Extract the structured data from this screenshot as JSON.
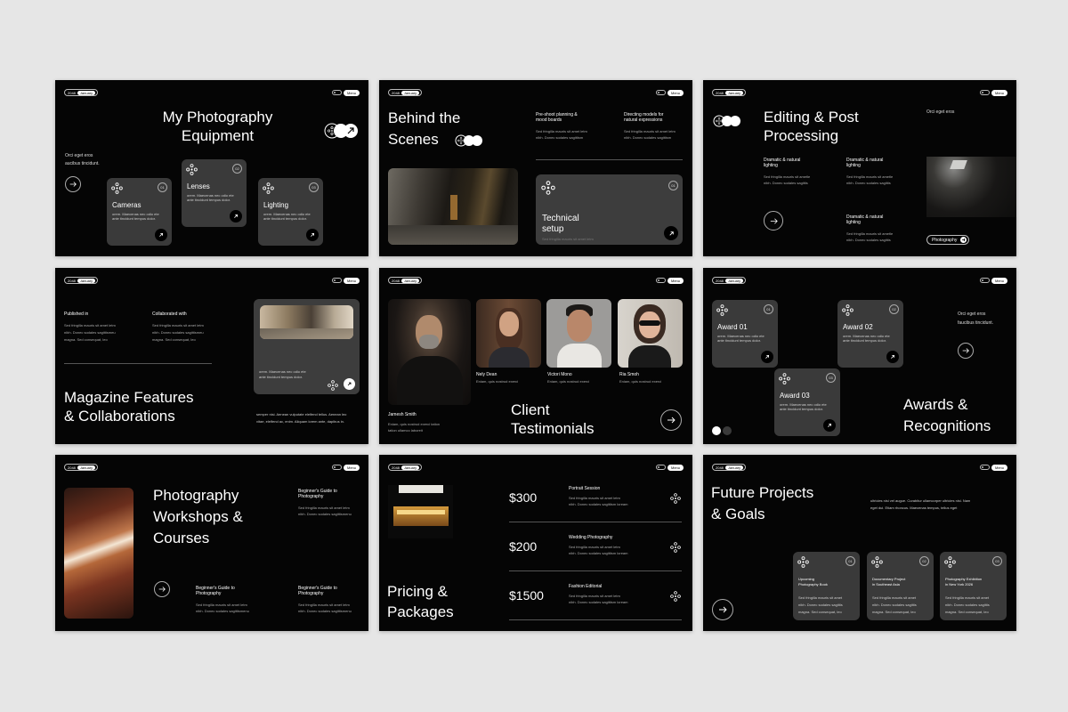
{
  "common": {
    "year": "2048",
    "month": "January",
    "menu": "Menu"
  },
  "s1": {
    "title": "My Photography Equipment",
    "intro1": "Orci eget eros",
    "intro2": "aucibus tincidunt.",
    "cards": [
      {
        "num": "01",
        "title": "Cameras",
        "desc1": "orem. Maecenas nec odio ete",
        "desc2": "ante tincidunt tempus dolor."
      },
      {
        "num": "02",
        "title": "Lenses",
        "desc1": "orem. Maecenas nec odio ete",
        "desc2": "ante tincidunt tempus dolor."
      },
      {
        "num": "03",
        "title": "Lighting",
        "desc1": "orem. Maecenas nec odio ete",
        "desc2": "ante tincidunt tempus dolor."
      }
    ]
  },
  "s2": {
    "title1": "Behind the",
    "title2": "Scenes",
    "col1h1": "Pre-shoot planning &",
    "col1h2": "mood boards",
    "col2h1": "Directing models for",
    "col2h2": "natural expressions",
    "body1": "Sed fringilla mauris sit amet letm",
    "body2": "nibh. Donec sodales sagittism",
    "card_num": "01",
    "card_t1": "Technical",
    "card_t2": "setup",
    "card_desc": "Sed fringilla mauris sit amet letm"
  },
  "s3": {
    "title1": "Editing & Post",
    "title2": "Processing",
    "aside": "Orci eget eros",
    "h1a": "Dramatic & natural",
    "h1b": "lighting",
    "body1": "Sed fringilla mauris sit ametle",
    "body2": "nibh. Donec sodales sagittis",
    "tag": "Photography"
  },
  "s4": {
    "label1": "Published in",
    "label2": "Collaborated with",
    "body1": "Sed fringilla mauris sit amet letm",
    "body2": "nibh. Donec sodales sagittismeu",
    "body3": "magna. Sed consequat, leo",
    "title1": "Magazine Features",
    "title2": "& Collaborations",
    "card1": "orem. Maecenas nec odio ete",
    "card2": "ante tincidunt tempus dolor.",
    "foot1": "semper nisi. Aenean vulputate eleifend tellus. Aenean leo",
    "foot2": "vitae, eleifend ac, enim. Aliquam lorem ante, dapibus in."
  },
  "s5": {
    "people": [
      {
        "name": "Jamesh Smith",
        "d1": "Eniam, quis nostrud exerci tation",
        "d2": "tation ullamco laboreit"
      },
      {
        "name": "Nely Dean",
        "d1": "Eniam, quis nostrud exerci",
        "d2": ""
      },
      {
        "name": "Victori Mono",
        "d1": "Eniam, quis nostrud exerci",
        "d2": ""
      },
      {
        "name": "Ria Smoh",
        "d1": "Eniam, quis nostrud exerci",
        "d2": ""
      }
    ],
    "title1": "Client",
    "title2": "Testimonials"
  },
  "s6": {
    "cards": [
      {
        "num": "01",
        "title": "Award 01"
      },
      {
        "num": "02",
        "title": "Award 02"
      },
      {
        "num": "03",
        "title": "Award 03"
      }
    ],
    "desc1": "orem. Maecenas nec odio ete",
    "desc2": "ante tincidunt tempus dolor.",
    "aside1": "Orci eget eros",
    "aside2": "faucibus tincidunt.",
    "title1": "Awards &",
    "title2": "Recognitions"
  },
  "s7": {
    "title1": "Photography",
    "title2": "Workshops &",
    "title3": "Courses",
    "guide1": "Beginner's Guide to",
    "guide2": "Photography",
    "body1": "Sed fringilla mauris sit amet letm",
    "body2": "nibh. Donec sodales sagittismenu"
  },
  "s8": {
    "prices": [
      {
        "price": "$300",
        "label": "Portrait Session"
      },
      {
        "price": "$200",
        "label": "Wedding Photography"
      },
      {
        "price": "$1500",
        "label": "Fashion Editorial"
      }
    ],
    "body1": "Sed fringilla mauris sit amet letm",
    "body2": "nibh. Donec sodales sagittism  loream",
    "title1": "Pricing &",
    "title2": "Packages"
  },
  "s9": {
    "title1": "Future Projects",
    "title2": "& Goals",
    "aside1": "ultricies nisi vel augue. Curabitur ullamcorper ultricies nisi. Nam",
    "aside2": "eget dui. Etiam rhoncus. Maecenas tempus, tellus eget",
    "cards": [
      {
        "num": "01",
        "t1": "Upcoming",
        "t2": "Photography Book"
      },
      {
        "num": "02",
        "t1": "Documentary Project",
        "t2": "in Southeast Asia"
      },
      {
        "num": "03",
        "t1": "Photography Exhibition",
        "t2": "in New York 2026"
      }
    ],
    "body1": "Sed fringilla mauris sit amet",
    "body2": "nibh. Donec sodales sagittis",
    "body3": "magna. Sed consequat, leo"
  }
}
